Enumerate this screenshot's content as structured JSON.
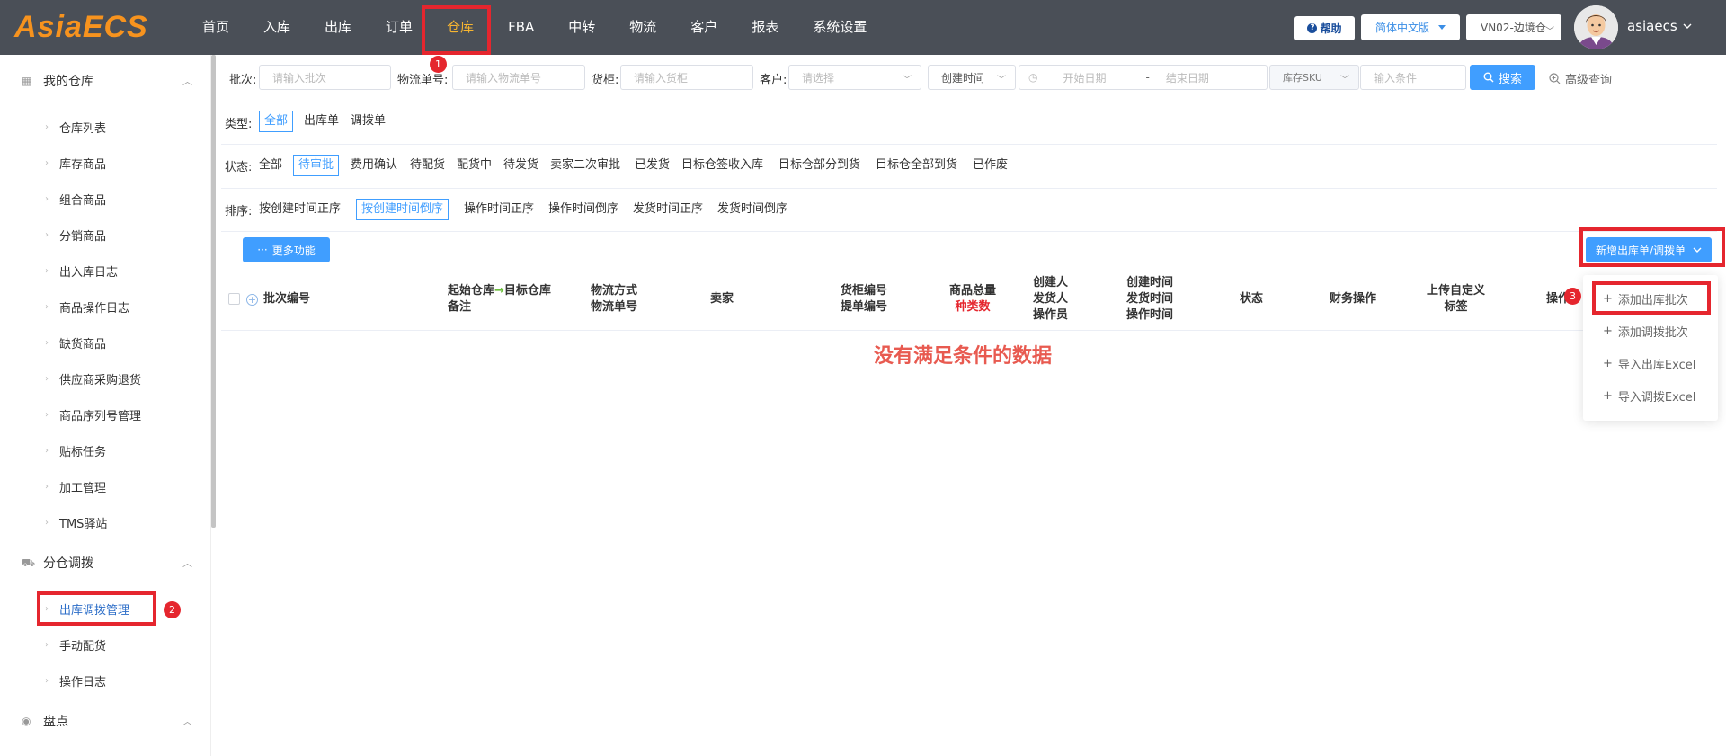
{
  "brand": {
    "logo_text": "AsiaECS",
    "logo_color": "#f7931e"
  },
  "nav": {
    "items": [
      "首页",
      "入库",
      "出库",
      "订单",
      "仓库",
      "FBA",
      "中转",
      "物流",
      "客户",
      "报表",
      "系统设置"
    ],
    "active_index": 4
  },
  "header": {
    "help_label": "帮助",
    "help_icon_glyph": "?",
    "language_label": "简体中文版",
    "warehouse_value": "VN02-边境仓",
    "username": "asiaecs"
  },
  "sidebar": {
    "groups": [
      {
        "label": "我的仓库",
        "items": [
          "仓库列表",
          "库存商品",
          "组合商品",
          "分销商品",
          "出入库日志",
          "商品操作日志",
          "缺货商品",
          "供应商采购退货",
          "商品序列号管理",
          "贴标任务",
          "加工管理",
          "TMS驿站"
        ]
      },
      {
        "label": "分仓调拨",
        "items": [
          "出库调拨管理",
          "手动配货",
          "操作日志"
        ]
      },
      {
        "label": "盘点",
        "items": []
      }
    ],
    "active_item": "出库调拨管理"
  },
  "filters": {
    "batch_label": "批次:",
    "batch_placeholder": "请输入批次",
    "logistics_label": "物流单号:",
    "logistics_placeholder": "请输入物流单号",
    "container_label": "货柜:",
    "container_placeholder": "请输入货柜",
    "customer_label": "客户:",
    "customer_placeholder": "请选择",
    "time_type_value": "创建时间",
    "start_date_placeholder": "开始日期",
    "date_sep": "-",
    "end_date_placeholder": "结束日期",
    "sku_type_value": "库存SKU",
    "condition_placeholder": "输入条件",
    "search_label": "搜索",
    "advanced_label": "高级查询"
  },
  "type_row": {
    "label": "类型:",
    "options": [
      "全部",
      "出库单",
      "调拨单"
    ],
    "selected": "全部"
  },
  "status_row": {
    "label": "状态:",
    "options": [
      "全部",
      "待审批",
      "费用确认",
      "待配货",
      "配货中",
      "待发货",
      "卖家二次审批",
      "已发货",
      "目标仓签收入库",
      "目标仓部分到货",
      "目标仓全部到货",
      "已作废"
    ],
    "selected": "待审批"
  },
  "sort_row": {
    "label": "排序:",
    "options": [
      "按创建时间正序",
      "按创建时间倒序",
      "操作时间正序",
      "操作时间倒序",
      "发货时间正序",
      "发货时间倒序"
    ],
    "selected": "按创建时间倒序"
  },
  "toolbar": {
    "more_label": "更多功能",
    "new_label": "新增出库单/调拨单"
  },
  "table": {
    "col_batch": "批次编号",
    "col_route_from": "起始仓库",
    "col_route_to": "目标仓库",
    "col_route_note": "备注",
    "col_logistics_1": "物流方式",
    "col_logistics_2": "物流单号",
    "col_seller": "卖家",
    "col_container_1": "货柜编号",
    "col_container_2": "提单编号",
    "col_qty_1": "商品总量",
    "col_qty_2": "种类数",
    "col_people_1": "创建人",
    "col_people_2": "发货人",
    "col_people_3": "操作员",
    "col_time_1": "创建时间",
    "col_time_2": "发货时间",
    "col_time_3": "操作时间",
    "col_status": "状态",
    "col_finance": "财务操作",
    "col_upload_1": "上传自定义",
    "col_upload_2": "标签",
    "col_ops": "操作",
    "empty_text": "没有满足条件的数据"
  },
  "dropdown": {
    "items": [
      "添加出库批次",
      "添加调拨批次",
      "导入出库Excel",
      "导入调拨Excel"
    ]
  },
  "annotations": {
    "badge_1": "1",
    "badge_2": "2",
    "badge_3": "3",
    "highlight_color": "#e5262e"
  },
  "accent_color": "#409eff"
}
